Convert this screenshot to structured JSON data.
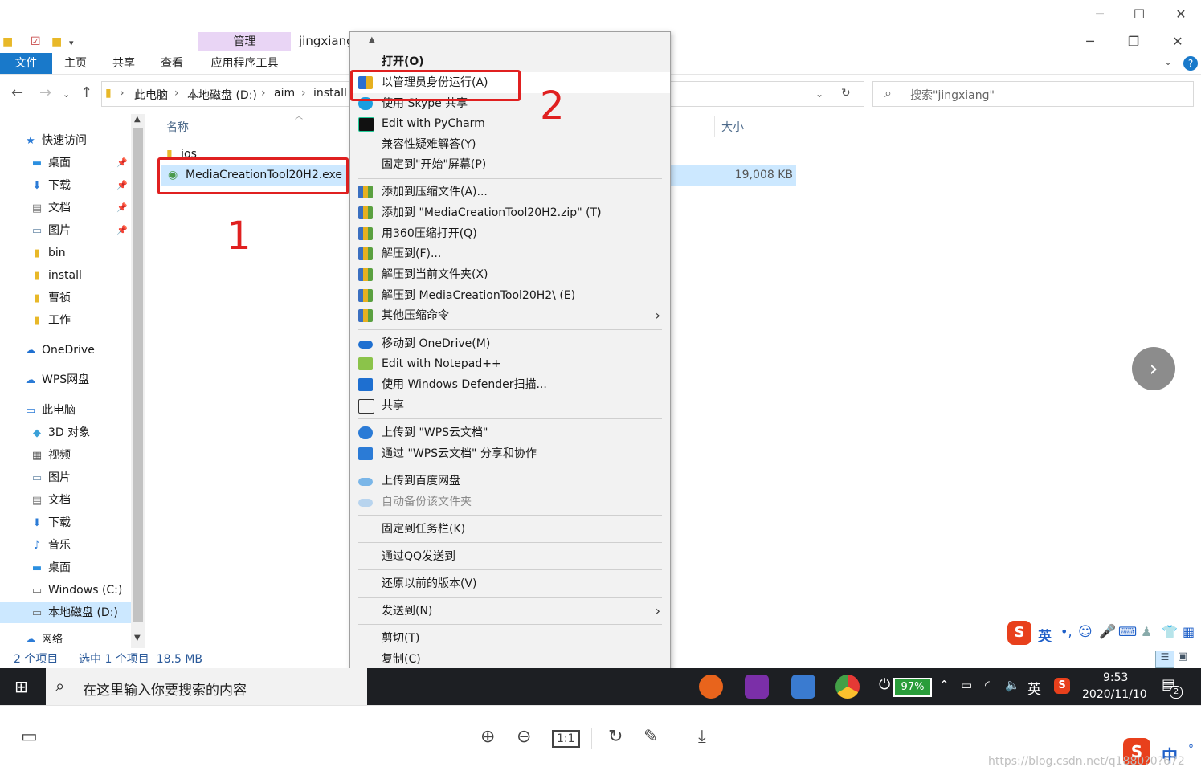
{
  "viewer": {
    "window_controls": [
      "─",
      "☐",
      "✕"
    ],
    "toolbar_icons": [
      "thumbnails-icon",
      "zoom-in-icon",
      "zoom-out-icon",
      "actual-size-icon",
      "rotate-icon",
      "edit-icon",
      "download-icon"
    ],
    "actual_size_label": "1:1",
    "next_label": "›",
    "watermark": "https://blog.csdn.net/q1880?0?672"
  },
  "explorer": {
    "context_tab_group": "管理",
    "title": "jingxiang",
    "tabs": [
      "文件",
      "主页",
      "共享",
      "查看",
      "应用程序工具"
    ],
    "window_controls": [
      "─",
      "❐",
      "✕"
    ],
    "help": "?",
    "breadcrumb": [
      "此电脑",
      "本地磁盘 (D:)",
      "aim",
      "install"
    ],
    "search_placeholder": "搜索\"jingxiang\"",
    "nav": {
      "quick_access": "快速访问",
      "quick_items": [
        "桌面",
        "下载",
        "文档",
        "图片",
        "bin",
        "install",
        "曹祯",
        "工作"
      ],
      "onedrive": "OneDrive",
      "wps": "WPS网盘",
      "this_pc": "此电脑",
      "pc_items": [
        "3D 对象",
        "视频",
        "图片",
        "文档",
        "下载",
        "音乐",
        "桌面",
        "Windows (C:)",
        "本地磁盘 (D:)"
      ],
      "network": "网络"
    },
    "columns": {
      "name": "名称",
      "size": "大小"
    },
    "files": [
      {
        "name": "ios",
        "size": ""
      },
      {
        "name": "MediaCreationTool20H2.exe",
        "size": "19,008 KB"
      }
    ],
    "status": {
      "count": "2 个项目",
      "selected": "选中 1 个项目  18.5 MB"
    }
  },
  "annotations": {
    "step1": "1",
    "step2": "2"
  },
  "context_menu": {
    "items": [
      "打开(O)",
      "以管理员身份运行(A)",
      "使用 Skype 共享",
      "Edit with PyCharm",
      "兼容性疑难解答(Y)",
      "固定到\"开始\"屏幕(P)",
      "添加到压缩文件(A)...",
      "添加到 \"MediaCreationTool20H2.zip\" (T)",
      "用360压缩打开(Q)",
      "解压到(F)...",
      "解压到当前文件夹(X)",
      "解压到 MediaCreationTool20H2\\ (E)",
      "其他压缩命令",
      "移动到 OneDrive(M)",
      "Edit with Notepad++",
      "使用 Windows Defender扫描...",
      "共享",
      "上传到 \"WPS云文档\"",
      "通过 \"WPS云文档\" 分享和协作",
      "上传到百度网盘",
      "自动备份该文件夹",
      "固定到任务栏(K)",
      "通过QQ发送到",
      "还原以前的版本(V)",
      "发送到(N)",
      "剪切(T)",
      "复制(C)"
    ]
  },
  "taskbar": {
    "search_placeholder": "在这里输入你要搜索的内容",
    "battery": "97%",
    "lang": "英",
    "time": "9:53",
    "date": "2020/11/10",
    "notification_count": "2"
  },
  "ime": {
    "lang": "英",
    "lang2": "中"
  }
}
